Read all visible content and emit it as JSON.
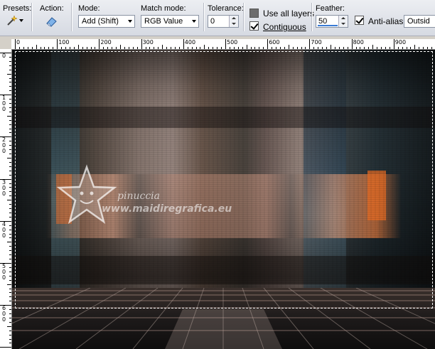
{
  "toolbar": {
    "presets": {
      "label": "Presets:",
      "icon": "magic-wand-icon"
    },
    "action": {
      "label": "Action:",
      "icon": "eraser-icon"
    },
    "mode": {
      "label": "Mode:",
      "value": "Add (Shift)"
    },
    "match_mode": {
      "label": "Match mode:",
      "value": "RGB Value"
    },
    "tolerance": {
      "label": "Tolerance:",
      "value": "0"
    },
    "use_all_layers": {
      "label": "Use all layers",
      "checked": false
    },
    "contiguous": {
      "label": "Contiguous",
      "checked": true
    },
    "feather": {
      "label": "Feather:",
      "value": "50"
    },
    "anti_alias": {
      "label": "Anti-alias",
      "checked": true
    },
    "outside": {
      "value": "Outsid"
    }
  },
  "ruler_top": [
    "0",
    "100",
    "200",
    "300",
    "400",
    "500",
    "600",
    "700",
    "800",
    "900"
  ],
  "ruler_left": [
    "0",
    "1\n0\n0",
    "2\n0\n0",
    "3\n0\n0",
    "4\n0\n0",
    "5\n0\n0",
    "6\n0\n0"
  ],
  "watermark": {
    "line1": "pinuccia",
    "line2": "www.maidiregrafica.eu"
  },
  "colors": {
    "accent_orange": "#e0702a",
    "peach": "#d9a08a",
    "teal": "#3d5560",
    "dark": "#1e1a18"
  }
}
